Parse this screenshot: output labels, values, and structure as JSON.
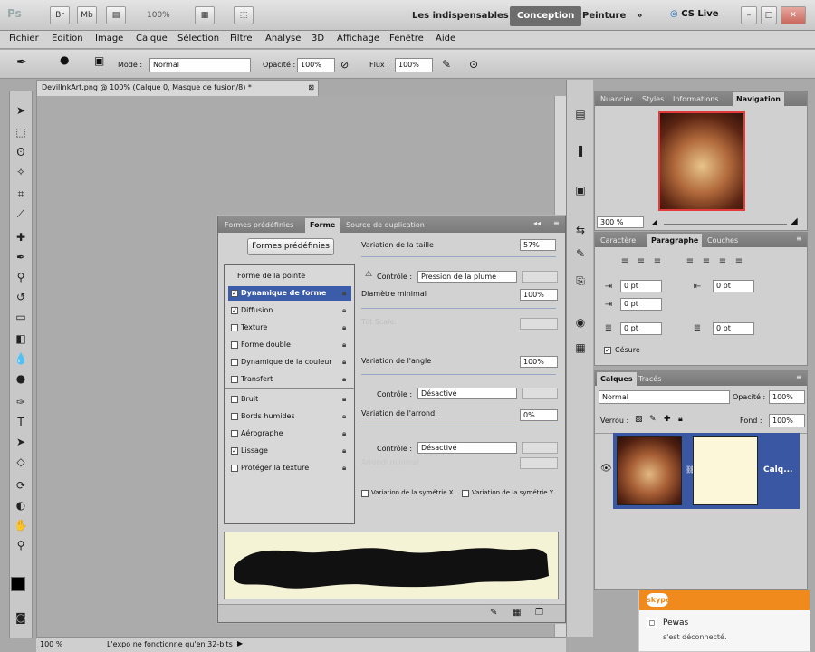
{
  "appbar": {
    "logo": "Ps",
    "zoom": "100%",
    "workspaces": [
      "Les indispensables",
      "Conception",
      "Peinture"
    ],
    "more": "»",
    "cslive": "CS Live"
  },
  "menu": [
    "Fichier",
    "Edition",
    "Image",
    "Calque",
    "Sélection",
    "Filtre",
    "Analyse",
    "3D",
    "Affichage",
    "Fenêtre",
    "Aide"
  ],
  "options": {
    "mode_label": "Mode :",
    "mode_value": "Normal",
    "opacity_label": "Opacité :",
    "opacity_value": "100%",
    "flux_label": "Flux :",
    "flux_value": "100%"
  },
  "document": {
    "tab_title": "DevilInkArt.png @ 100% (Calque 0, Masque de fusion/8) *",
    "close": "⊠"
  },
  "status": {
    "zoom": "100 %",
    "message": "L'expo ne fonctionne qu'en 32-bits"
  },
  "brush_panel": {
    "tabs": [
      "Formes prédéfinies",
      "Forme",
      "Source de duplication"
    ],
    "presets_button": "Formes prédéfinies",
    "items": [
      {
        "label": "Forme de la pointe",
        "checkbox": false,
        "lock": false,
        "selected": false
      },
      {
        "label": "Dynamique de forme",
        "checkbox": true,
        "checked": true,
        "lock": true,
        "selected": true
      },
      {
        "label": "Diffusion",
        "checkbox": true,
        "checked": true,
        "lock": true,
        "selected": false
      },
      {
        "label": "Texture",
        "checkbox": true,
        "checked": false,
        "lock": true,
        "selected": false
      },
      {
        "label": "Forme double",
        "checkbox": true,
        "checked": false,
        "lock": true,
        "selected": false
      },
      {
        "label": "Dynamique de la couleur",
        "checkbox": true,
        "checked": false,
        "lock": true,
        "selected": false
      },
      {
        "label": "Transfert",
        "checkbox": true,
        "checked": false,
        "lock": true,
        "selected": false
      },
      {
        "label": "Bruit",
        "checkbox": true,
        "checked": false,
        "lock": true,
        "selected": false
      },
      {
        "label": "Bords humides",
        "checkbox": true,
        "checked": false,
        "lock": true,
        "selected": false
      },
      {
        "label": "Aérographe",
        "checkbox": true,
        "checked": false,
        "lock": true,
        "selected": false
      },
      {
        "label": "Lissage",
        "checkbox": true,
        "checked": true,
        "lock": true,
        "selected": false
      },
      {
        "label": "Protéger la texture",
        "checkbox": true,
        "checked": false,
        "lock": true,
        "selected": false
      }
    ],
    "size_jitter_label": "Variation de la taille",
    "size_jitter_value": "57%",
    "control_label": "Contrôle :",
    "control1_value": "Pression de la plume",
    "min_diameter_label": "Diamètre minimal",
    "min_diameter_value": "100%",
    "tilt_scale_label": "Tilt Scale:",
    "angle_jitter_label": "Variation de l'angle",
    "angle_jitter_value": "100%",
    "control2_value": "Désactivé",
    "roundness_jitter_label": "Variation de l'arrondi",
    "roundness_jitter_value": "0%",
    "control3_value": "Désactivé",
    "min_roundness_label": "Arrondi minimal",
    "flip_x_label": "Variation de la symétrie X",
    "flip_y_label": "Variation de la symétrie Y"
  },
  "nav_panel": {
    "tabs": [
      "Nuancier",
      "Styles",
      "Informations",
      "Navigation"
    ],
    "zoom": "300 %"
  },
  "para_panel": {
    "tabs": [
      "Caractère",
      "Paragraphe",
      "Couches"
    ],
    "indent_values": [
      "0 pt",
      "0 pt",
      "0 pt",
      "0 pt",
      "0 pt"
    ],
    "hyphen_label": "Césure"
  },
  "layers_panel": {
    "tabs": [
      "Calques",
      "Tracés"
    ],
    "blend_mode": "Normal",
    "opacity_label": "Opacité :",
    "opacity_value": "100%",
    "lock_label": "Verrou :",
    "fill_label": "Fond :",
    "fill_value": "100%",
    "layer_name": "Calq..."
  },
  "skype": {
    "brand": "skype",
    "name": "Pewas",
    "status": "s'est déconnecté."
  }
}
